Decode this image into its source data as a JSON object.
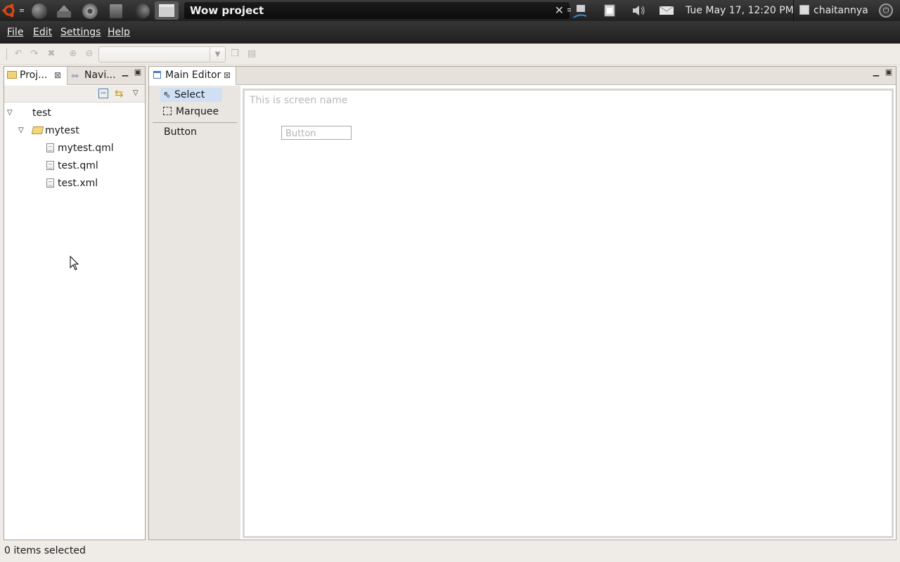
{
  "panel": {
    "window_title": "Wow project",
    "clock": "Tue May 17, 12:20 PM",
    "user": "chaitannya",
    "close_glyph": "✕"
  },
  "menubar": {
    "items": [
      "File",
      "Edit",
      "Settings",
      "Help"
    ]
  },
  "left_panel": {
    "tabs": [
      "Proj...",
      "Navi..."
    ],
    "tree": {
      "root": "test",
      "folder": "mytest",
      "files": [
        "mytest.qml",
        "test.qml",
        "test.xml"
      ]
    }
  },
  "editor": {
    "tab_label": "Main Editor",
    "palette": {
      "select": "Select",
      "marquee": "Marquee",
      "button": "Button"
    },
    "canvas": {
      "screen_name": "This is screen name",
      "button_label": "Button"
    }
  },
  "status": {
    "text": "0 items selected"
  },
  "icons": [
    "ubuntu-logo-icon",
    "firefox-icon",
    "install-icon",
    "disc-icon",
    "files-icon",
    "terminal-icon",
    "window-icon",
    "network-icon",
    "battery-icon",
    "volume-icon",
    "mail-icon",
    "power-icon"
  ],
  "colors": {
    "panel_bg": "#2a2a2a",
    "selection": "#cfe0f4",
    "ubuntu_orange": "#dd4814"
  }
}
